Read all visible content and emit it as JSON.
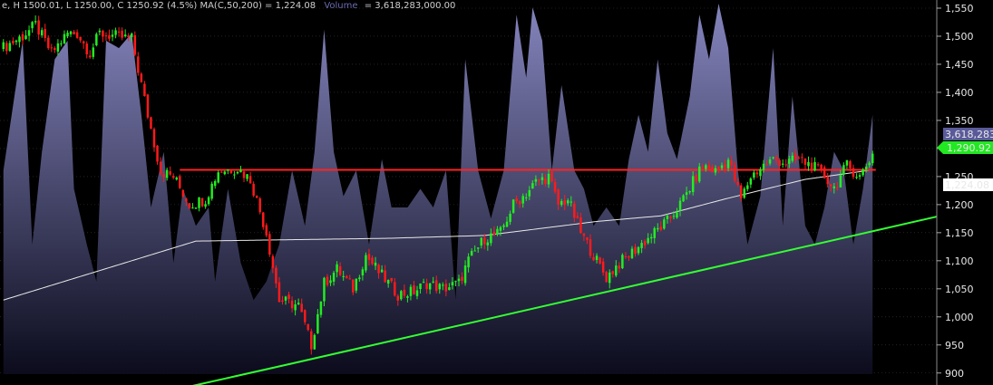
{
  "header": {
    "text": "e, H 1500.01, L 1250.00, C 1250.92 (4.5%) MA(C,50,200) = 1,224.08",
    "volume_label": "Volume",
    "volume_value": "= 3,618,283,000.00"
  },
  "colors": {
    "background": "#000000",
    "up_candle": "#22ee22",
    "down_candle": "#ff1a1a",
    "volume_fill_top": "#8c8cc8",
    "volume_fill_bottom": "#0c0c1e",
    "ma_line": "#e8e8e8",
    "resistance_line": "#ff2222",
    "support_line": "#33ff33",
    "price_badge": "#22e822",
    "ma_badge": "#ffffff",
    "volume_badge": "#5a5a9a",
    "axis_text": "#e8e8e8",
    "grid": "#3a3a3a"
  },
  "chart_data": {
    "type": "candlestick",
    "title": "",
    "xlabel": "",
    "ylabel": "",
    "ylim": [
      860,
      1575
    ],
    "y_ticks": [
      "1,550",
      "1,500",
      "1,450",
      "1,400",
      "1,350",
      "1,300",
      "1,250",
      "1,200",
      "1,150",
      "1,100",
      "1,050",
      "1,000",
      "950",
      "900"
    ],
    "y_tick_values": [
      1550,
      1500,
      1450,
      1400,
      1350,
      1300,
      1250,
      1200,
      1150,
      1100,
      1050,
      1000,
      950,
      900
    ],
    "grid": true,
    "series": [
      {
        "name": "Price",
        "kind": "ohlc",
        "anchors": [
          [
            0,
            1480
          ],
          [
            6,
            1500
          ],
          [
            10,
            1520
          ],
          [
            15,
            1470
          ],
          [
            20,
            1505
          ],
          [
            23,
            1505
          ],
          [
            27,
            1470
          ],
          [
            30,
            1505
          ],
          [
            35,
            1500
          ],
          [
            40,
            1495
          ],
          [
            45,
            1360
          ],
          [
            49,
            1260
          ],
          [
            53,
            1250
          ],
          [
            58,
            1200
          ],
          [
            63,
            1210
          ],
          [
            67,
            1260
          ],
          [
            73,
            1265
          ],
          [
            77,
            1245
          ],
          [
            82,
            1150
          ],
          [
            86,
            1030
          ],
          [
            92,
            1020
          ],
          [
            96,
            950
          ],
          [
            100,
            1060
          ],
          [
            104,
            1085
          ],
          [
            109,
            1050
          ],
          [
            113,
            1110
          ],
          [
            117,
            1080
          ],
          [
            123,
            1040
          ],
          [
            128,
            1045
          ],
          [
            132,
            1060
          ],
          [
            137,
            1050
          ],
          [
            142,
            1060
          ],
          [
            145,
            1100
          ],
          [
            150,
            1140
          ],
          [
            155,
            1150
          ],
          [
            159,
            1200
          ],
          [
            163,
            1220
          ],
          [
            166,
            1240
          ],
          [
            170,
            1250
          ],
          [
            173,
            1200
          ],
          [
            176,
            1210
          ],
          [
            180,
            1150
          ],
          [
            184,
            1110
          ],
          [
            188,
            1070
          ],
          [
            191,
            1090
          ],
          [
            195,
            1110
          ],
          [
            199,
            1130
          ],
          [
            203,
            1150
          ],
          [
            207,
            1170
          ],
          [
            211,
            1200
          ],
          [
            215,
            1240
          ],
          [
            218,
            1270
          ],
          [
            222,
            1260
          ],
          [
            226,
            1280
          ],
          [
            230,
            1210
          ],
          [
            233,
            1250
          ],
          [
            237,
            1270
          ],
          [
            240,
            1280
          ],
          [
            244,
            1275
          ],
          [
            248,
            1280
          ],
          [
            252,
            1270
          ],
          [
            256,
            1250
          ],
          [
            259,
            1230
          ],
          [
            263,
            1270
          ],
          [
            267,
            1250
          ],
          [
            270,
            1280
          ],
          [
            271,
            1290
          ]
        ]
      },
      {
        "name": "Volume",
        "kind": "area",
        "anchors": [
          [
            0,
            0.55
          ],
          [
            6,
            0.9
          ],
          [
            9,
            0.35
          ],
          [
            12,
            0.6
          ],
          [
            16,
            0.85
          ],
          [
            20,
            0.9
          ],
          [
            22,
            0.5
          ],
          [
            26,
            0.35
          ],
          [
            29,
            0.25
          ],
          [
            32,
            0.9
          ],
          [
            36,
            0.88
          ],
          [
            40,
            0.92
          ],
          [
            43,
            0.7
          ],
          [
            46,
            0.45
          ],
          [
            50,
            0.6
          ],
          [
            53,
            0.3
          ],
          [
            56,
            0.5
          ],
          [
            60,
            0.4
          ],
          [
            64,
            0.45
          ],
          [
            66,
            0.25
          ],
          [
            70,
            0.5
          ],
          [
            74,
            0.3
          ],
          [
            78,
            0.2
          ],
          [
            82,
            0.25
          ],
          [
            86,
            0.35
          ],
          [
            90,
            0.55
          ],
          [
            94,
            0.4
          ],
          [
            97,
            0.6
          ],
          [
            100,
            0.93
          ],
          [
            103,
            0.6
          ],
          [
            106,
            0.48
          ],
          [
            110,
            0.55
          ],
          [
            114,
            0.35
          ],
          [
            118,
            0.58
          ],
          [
            121,
            0.45
          ],
          [
            126,
            0.45
          ],
          [
            130,
            0.5
          ],
          [
            134,
            0.45
          ],
          [
            138,
            0.55
          ],
          [
            141,
            0.2
          ],
          [
            144,
            0.85
          ],
          [
            148,
            0.55
          ],
          [
            152,
            0.42
          ],
          [
            156,
            0.55
          ],
          [
            160,
            0.97
          ],
          [
            163,
            0.8
          ],
          [
            165,
            0.99
          ],
          [
            168,
            0.9
          ],
          [
            171,
            0.55
          ],
          [
            174,
            0.78
          ],
          [
            178,
            0.55
          ],
          [
            181,
            0.5
          ],
          [
            184,
            0.4
          ],
          [
            188,
            0.45
          ],
          [
            192,
            0.4
          ],
          [
            195,
            0.58
          ],
          [
            198,
            0.7
          ],
          [
            201,
            0.6
          ],
          [
            204,
            0.85
          ],
          [
            207,
            0.65
          ],
          [
            210,
            0.58
          ],
          [
            214,
            0.75
          ],
          [
            217,
            0.97
          ],
          [
            220,
            0.85
          ],
          [
            223,
            1.0
          ],
          [
            226,
            0.88
          ],
          [
            229,
            0.55
          ],
          [
            232,
            0.35
          ],
          [
            236,
            0.48
          ],
          [
            240,
            0.88
          ],
          [
            243,
            0.4
          ],
          [
            246,
            0.75
          ],
          [
            250,
            0.4
          ],
          [
            253,
            0.35
          ],
          [
            256,
            0.45
          ],
          [
            259,
            0.6
          ],
          [
            262,
            0.55
          ],
          [
            265,
            0.35
          ],
          [
            268,
            0.5
          ],
          [
            271,
            0.7
          ]
        ]
      },
      {
        "name": "MA",
        "kind": "line",
        "anchors": [
          [
            0,
            1030
          ],
          [
            60,
            1135
          ],
          [
            120,
            1140
          ],
          [
            150,
            1145
          ],
          [
            185,
            1170
          ],
          [
            205,
            1180
          ],
          [
            225,
            1210
          ],
          [
            250,
            1245
          ],
          [
            271,
            1262
          ]
        ]
      }
    ],
    "resistance_line": {
      "x_range": [
        55,
        272
      ],
      "y": 1262
    },
    "support_line": {
      "points": [
        [
          48,
          863
        ],
        [
          90,
          917
        ],
        [
          299,
          1189
        ]
      ]
    },
    "bar_count": 272,
    "price_range_days": 300,
    "last_price_label": "1,290.92",
    "ma_label": "1,224.08",
    "volume_label": "3,618,283"
  }
}
